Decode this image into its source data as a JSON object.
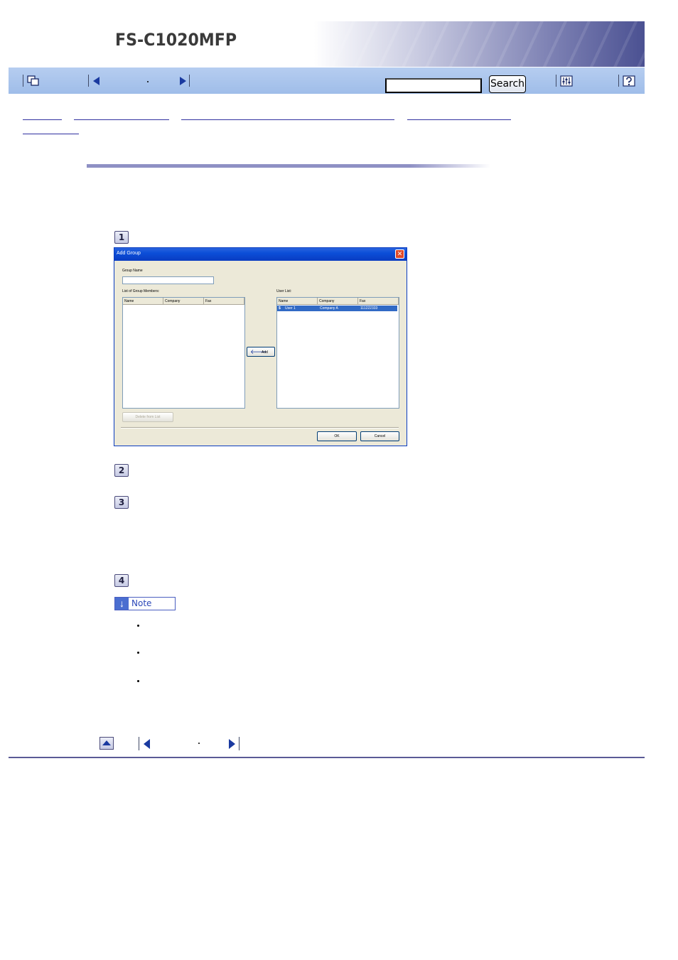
{
  "header": {
    "product_name": "FS-C1020MFP"
  },
  "toolbar": {
    "search_value": "",
    "search_button_label": "Search",
    "icons": [
      "contents-icon",
      "previous-page-icon",
      "next-page-icon",
      "settings-icon",
      "help-icon"
    ]
  },
  "steps": [
    "1",
    "2",
    "3",
    "4"
  ],
  "dialog": {
    "title": "Add Group",
    "group_name_label": "Group Name",
    "group_name_value": "",
    "members_label": "List of Group Members:",
    "members_columns": [
      "Name",
      "Company",
      "Fax"
    ],
    "user_list_label": "User List:",
    "user_list_columns": [
      "Name",
      "Company",
      "Fax"
    ],
    "user_rows": [
      {
        "name": "User 1",
        "company": "Company A",
        "fax": "111222333"
      }
    ],
    "add_button_label": "Add",
    "delete_button_label": "Delete from List",
    "ok_button_label": "OK",
    "cancel_button_label": "Cancel"
  },
  "note": {
    "label": "Note"
  },
  "colors": {
    "toolbar": "#a8c4ee",
    "title_rule": "#8e90c4",
    "dialog_titlebar": "#0b4ed8",
    "selection": "#316ac5"
  }
}
